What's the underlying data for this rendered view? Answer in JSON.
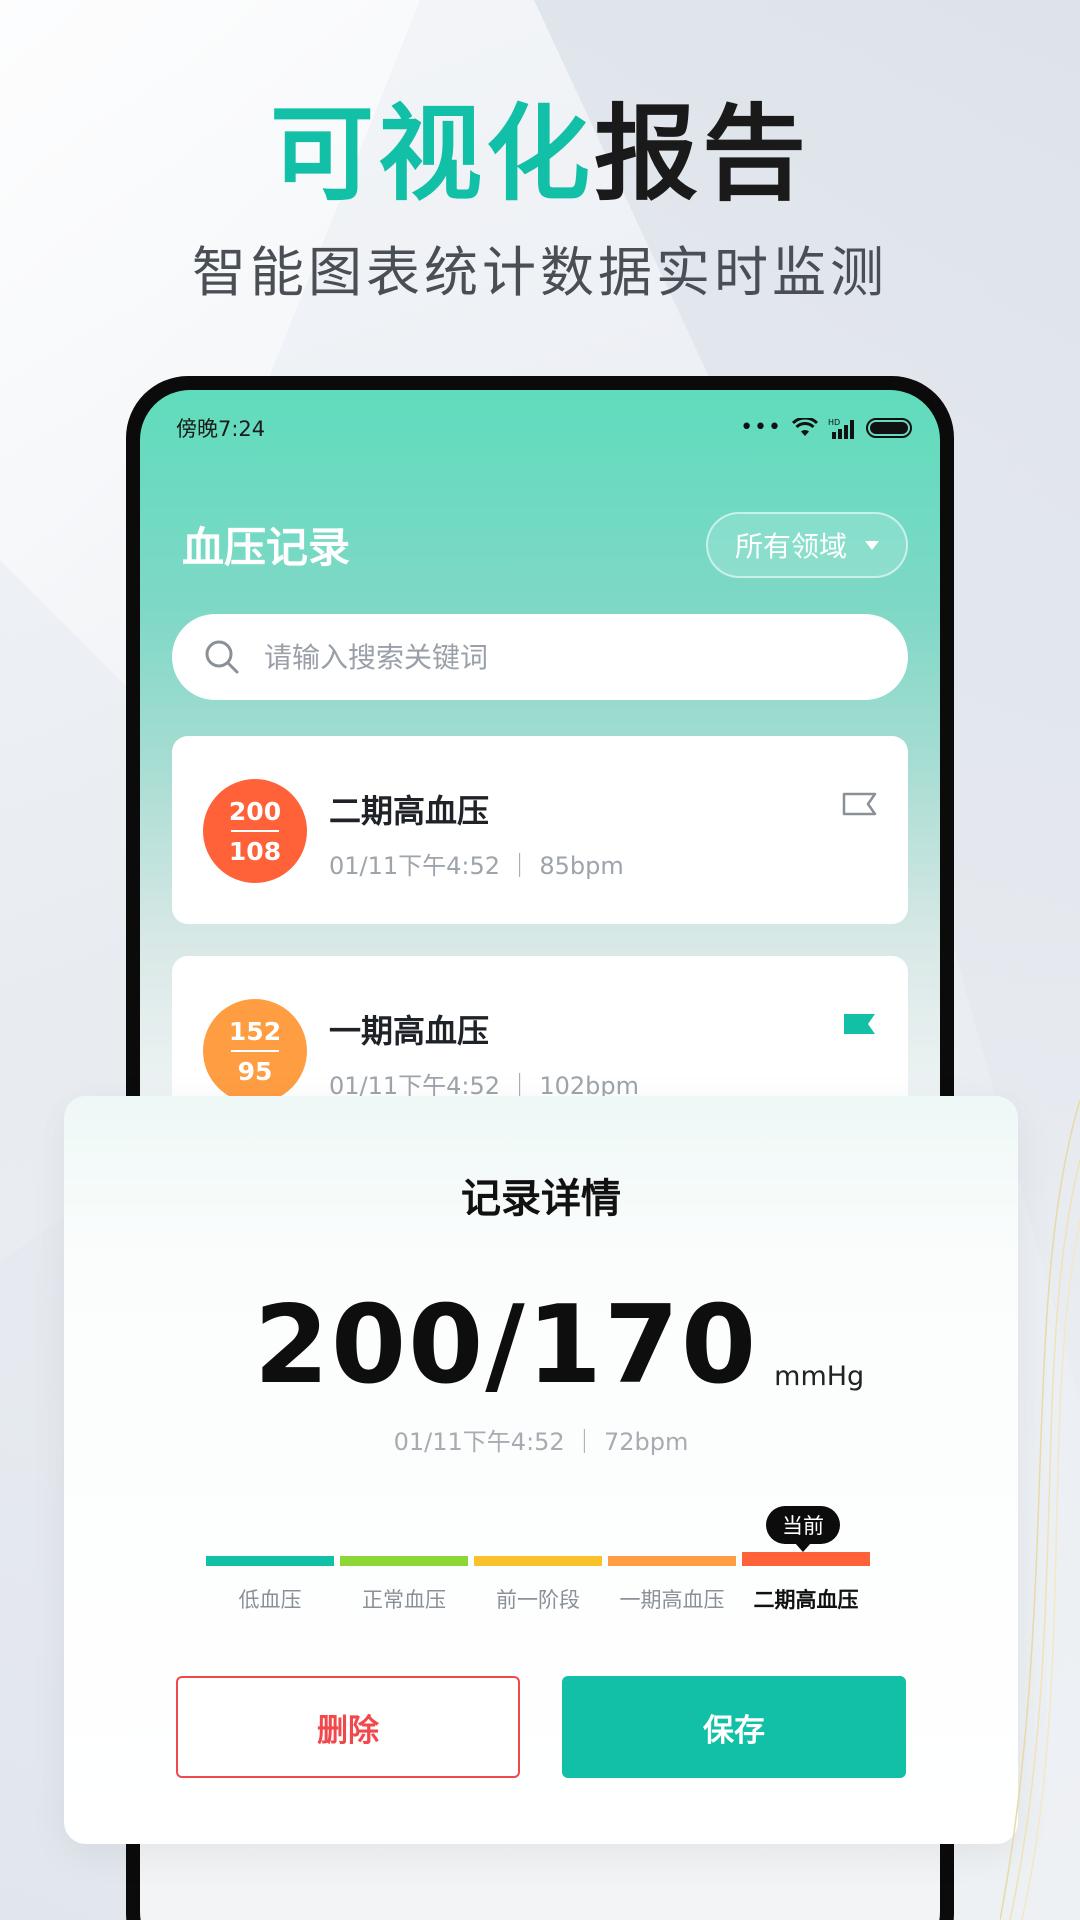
{
  "promo": {
    "headline_accent": "可视化",
    "headline_rest": "报告",
    "subheadline": "智能图表统计数据实时监测"
  },
  "status_bar": {
    "time": "傍晚7:24"
  },
  "app": {
    "title": "血压记录",
    "domain_filter": "所有领域",
    "search_placeholder": "请输入搜索关键词"
  },
  "records": [
    {
      "systolic": "200",
      "diastolic": "108",
      "level": "二期高血压",
      "meta": "01/11下午4:52 ｜ 85bpm",
      "color": "#ff6238",
      "flagged": false
    },
    {
      "systolic": "152",
      "diastolic": "95",
      "level": "一期高血压",
      "meta": "01/11下午4:52 ｜ 102bpm",
      "color": "#ff9d42",
      "flagged": true
    }
  ],
  "detail": {
    "title": "记录详情",
    "reading": "200/170",
    "unit": "mmHg",
    "meta": "01/11下午4:52 ｜ 72bpm",
    "current_tag": "当前",
    "scale": [
      {
        "label": "低血压",
        "color": "#12bfa7"
      },
      {
        "label": "正常血压",
        "color": "#8cd636"
      },
      {
        "label": "前一阶段",
        "color": "#f9c22b"
      },
      {
        "label": "一期高血压",
        "color": "#ff9d42"
      },
      {
        "label": "二期高血压",
        "color": "#ff6238"
      }
    ],
    "current_index": 4,
    "delete_label": "删除",
    "save_label": "保存"
  },
  "colors": {
    "accent": "#12bfa7",
    "danger": "#f2484b"
  }
}
